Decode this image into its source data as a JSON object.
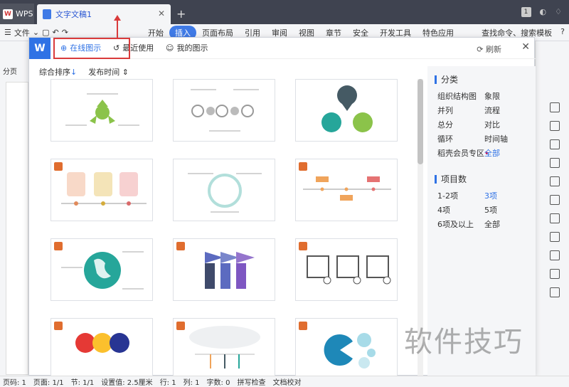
{
  "titlebar": {
    "wps_label": "WPS",
    "doc_tab": "文字文稿1",
    "tab_count": "1"
  },
  "menubar": {
    "file": "文件",
    "items": [
      "开始",
      "插入",
      "页面布局",
      "引用",
      "审阅",
      "视图",
      "章节",
      "安全",
      "开发工具",
      "特色应用"
    ],
    "search": "查找命令、搜索模板"
  },
  "left": {
    "paging": "分页"
  },
  "dialog": {
    "tabs": [
      "在线图示",
      "最近使用",
      "我的图示"
    ],
    "refresh": "刷新",
    "sort": [
      "综合排序",
      "发布时间"
    ],
    "category_title": "分类",
    "categories": [
      "组织结构图",
      "象限",
      "并列",
      "流程",
      "总分",
      "对比",
      "循环",
      "时间轴",
      "稻壳会员专区",
      "全部"
    ],
    "count_title": "项目数",
    "counts": [
      "1-2项",
      "3项",
      "4项",
      "5项",
      "6项及以上",
      "全部"
    ]
  },
  "statusbar": {
    "items": [
      "页码: 1",
      "页面: 1/1",
      "节: 1/1",
      "设置值: 2.5厘米",
      "行: 1",
      "列: 1",
      "字数: 0",
      "拼写检查",
      "文档校对"
    ]
  },
  "watermark": "软件技巧",
  "colors": {
    "accent": "#2f72e5",
    "highlight": "#d93b3b"
  }
}
